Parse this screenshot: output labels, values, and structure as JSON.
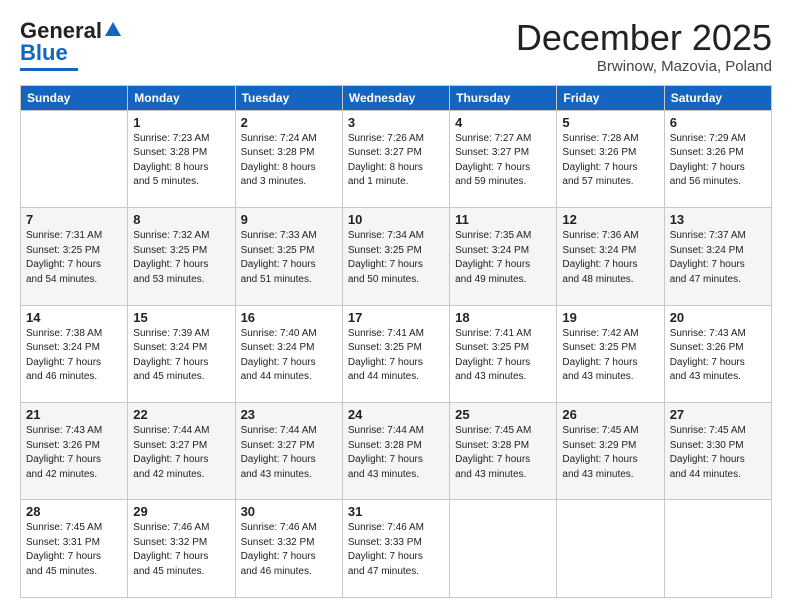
{
  "header": {
    "logo_general": "General",
    "logo_blue": "Blue",
    "month_title": "December 2025",
    "subtitle": "Brwinow, Mazovia, Poland"
  },
  "weekdays": [
    "Sunday",
    "Monday",
    "Tuesday",
    "Wednesday",
    "Thursday",
    "Friday",
    "Saturday"
  ],
  "weeks": [
    [
      {
        "day": "",
        "info": ""
      },
      {
        "day": "1",
        "info": "Sunrise: 7:23 AM\nSunset: 3:28 PM\nDaylight: 8 hours\nand 5 minutes."
      },
      {
        "day": "2",
        "info": "Sunrise: 7:24 AM\nSunset: 3:28 PM\nDaylight: 8 hours\nand 3 minutes."
      },
      {
        "day": "3",
        "info": "Sunrise: 7:26 AM\nSunset: 3:27 PM\nDaylight: 8 hours\nand 1 minute."
      },
      {
        "day": "4",
        "info": "Sunrise: 7:27 AM\nSunset: 3:27 PM\nDaylight: 7 hours\nand 59 minutes."
      },
      {
        "day": "5",
        "info": "Sunrise: 7:28 AM\nSunset: 3:26 PM\nDaylight: 7 hours\nand 57 minutes."
      },
      {
        "day": "6",
        "info": "Sunrise: 7:29 AM\nSunset: 3:26 PM\nDaylight: 7 hours\nand 56 minutes."
      }
    ],
    [
      {
        "day": "7",
        "info": "Sunrise: 7:31 AM\nSunset: 3:25 PM\nDaylight: 7 hours\nand 54 minutes."
      },
      {
        "day": "8",
        "info": "Sunrise: 7:32 AM\nSunset: 3:25 PM\nDaylight: 7 hours\nand 53 minutes."
      },
      {
        "day": "9",
        "info": "Sunrise: 7:33 AM\nSunset: 3:25 PM\nDaylight: 7 hours\nand 51 minutes."
      },
      {
        "day": "10",
        "info": "Sunrise: 7:34 AM\nSunset: 3:25 PM\nDaylight: 7 hours\nand 50 minutes."
      },
      {
        "day": "11",
        "info": "Sunrise: 7:35 AM\nSunset: 3:24 PM\nDaylight: 7 hours\nand 49 minutes."
      },
      {
        "day": "12",
        "info": "Sunrise: 7:36 AM\nSunset: 3:24 PM\nDaylight: 7 hours\nand 48 minutes."
      },
      {
        "day": "13",
        "info": "Sunrise: 7:37 AM\nSunset: 3:24 PM\nDaylight: 7 hours\nand 47 minutes."
      }
    ],
    [
      {
        "day": "14",
        "info": "Sunrise: 7:38 AM\nSunset: 3:24 PM\nDaylight: 7 hours\nand 46 minutes."
      },
      {
        "day": "15",
        "info": "Sunrise: 7:39 AM\nSunset: 3:24 PM\nDaylight: 7 hours\nand 45 minutes."
      },
      {
        "day": "16",
        "info": "Sunrise: 7:40 AM\nSunset: 3:24 PM\nDaylight: 7 hours\nand 44 minutes."
      },
      {
        "day": "17",
        "info": "Sunrise: 7:41 AM\nSunset: 3:25 PM\nDaylight: 7 hours\nand 44 minutes."
      },
      {
        "day": "18",
        "info": "Sunrise: 7:41 AM\nSunset: 3:25 PM\nDaylight: 7 hours\nand 43 minutes."
      },
      {
        "day": "19",
        "info": "Sunrise: 7:42 AM\nSunset: 3:25 PM\nDaylight: 7 hours\nand 43 minutes."
      },
      {
        "day": "20",
        "info": "Sunrise: 7:43 AM\nSunset: 3:26 PM\nDaylight: 7 hours\nand 43 minutes."
      }
    ],
    [
      {
        "day": "21",
        "info": "Sunrise: 7:43 AM\nSunset: 3:26 PM\nDaylight: 7 hours\nand 42 minutes."
      },
      {
        "day": "22",
        "info": "Sunrise: 7:44 AM\nSunset: 3:27 PM\nDaylight: 7 hours\nand 42 minutes."
      },
      {
        "day": "23",
        "info": "Sunrise: 7:44 AM\nSunset: 3:27 PM\nDaylight: 7 hours\nand 43 minutes."
      },
      {
        "day": "24",
        "info": "Sunrise: 7:44 AM\nSunset: 3:28 PM\nDaylight: 7 hours\nand 43 minutes."
      },
      {
        "day": "25",
        "info": "Sunrise: 7:45 AM\nSunset: 3:28 PM\nDaylight: 7 hours\nand 43 minutes."
      },
      {
        "day": "26",
        "info": "Sunrise: 7:45 AM\nSunset: 3:29 PM\nDaylight: 7 hours\nand 43 minutes."
      },
      {
        "day": "27",
        "info": "Sunrise: 7:45 AM\nSunset: 3:30 PM\nDaylight: 7 hours\nand 44 minutes."
      }
    ],
    [
      {
        "day": "28",
        "info": "Sunrise: 7:45 AM\nSunset: 3:31 PM\nDaylight: 7 hours\nand 45 minutes."
      },
      {
        "day": "29",
        "info": "Sunrise: 7:46 AM\nSunset: 3:32 PM\nDaylight: 7 hours\nand 45 minutes."
      },
      {
        "day": "30",
        "info": "Sunrise: 7:46 AM\nSunset: 3:32 PM\nDaylight: 7 hours\nand 46 minutes."
      },
      {
        "day": "31",
        "info": "Sunrise: 7:46 AM\nSunset: 3:33 PM\nDaylight: 7 hours\nand 47 minutes."
      },
      {
        "day": "",
        "info": ""
      },
      {
        "day": "",
        "info": ""
      },
      {
        "day": "",
        "info": ""
      }
    ]
  ]
}
